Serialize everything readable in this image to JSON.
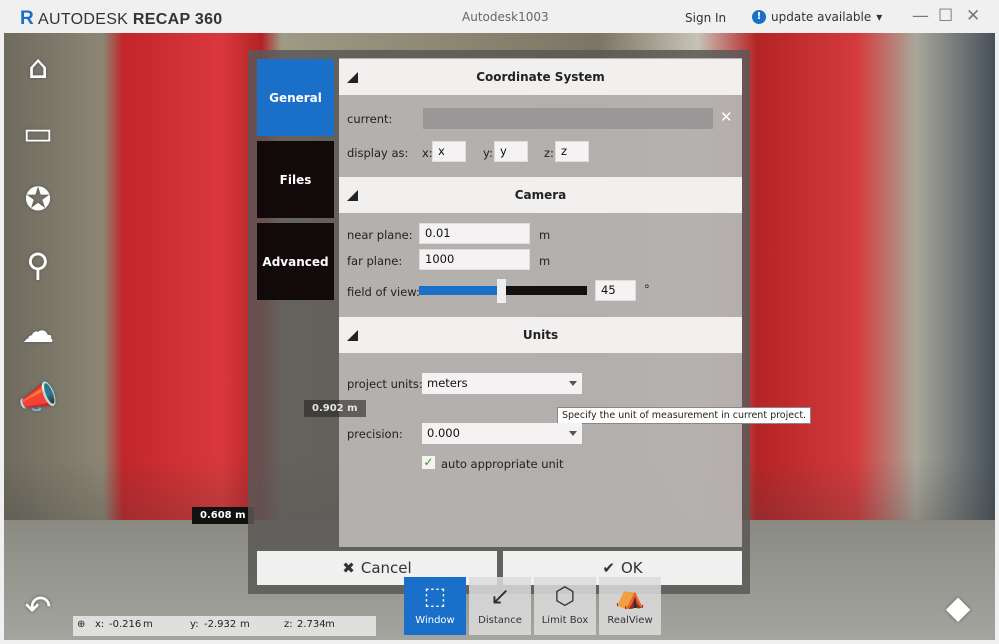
{
  "titlebar": {
    "logo": "AUTODESK",
    "product": "RECAP 360",
    "window_title": "Autodesk1003",
    "sign_in": "Sign In",
    "update": "update available"
  },
  "scene": {
    "measurements": [
      "0.608 m",
      "0.902 m"
    ]
  },
  "dialog": {
    "tabs": [
      {
        "label": "General",
        "active": true
      },
      {
        "label": "Files"
      },
      {
        "label": "Advanced"
      }
    ],
    "coordinate_system": {
      "title": "Coordinate System",
      "current_label": "current:",
      "current_value": "",
      "display_as_label": "display as:",
      "x_label": "x:",
      "x": "x",
      "y_label": "y:",
      "y": "y",
      "z_label": "z:",
      "z": "z"
    },
    "camera": {
      "title": "Camera",
      "near_label": "near plane:",
      "near": "0.01",
      "near_unit": "m",
      "far_label": "far plane:",
      "far": "1000",
      "far_unit": "m",
      "fov_label": "field of view:",
      "fov": "45",
      "fov_unit": "°",
      "fov_slider_fraction": 0.49
    },
    "units": {
      "title": "Units",
      "project_units_label": "project units:",
      "project_units": "meters",
      "tooltip": "Specify the unit of measurement in current project.",
      "precision_label": "precision:",
      "precision": "0.000",
      "auto_label": "auto appropriate unit",
      "auto_checked": true
    },
    "cancel": "Cancel",
    "ok": "OK"
  },
  "status": {
    "x_label": "x:",
    "x": "-0.216",
    "x_unit": "m",
    "y_label": "y:",
    "y": "-2.932",
    "y_unit": "m",
    "z_label": "z:",
    "z": "2.734",
    "z_unit": "m"
  },
  "bottom_tools": [
    {
      "label": "Window",
      "active": true
    },
    {
      "label": "Distance"
    },
    {
      "label": "Limit Box"
    },
    {
      "label": "RealView"
    }
  ],
  "colors": {
    "accent": "#1a6fc9",
    "tab_inactive": "#120a0a"
  }
}
